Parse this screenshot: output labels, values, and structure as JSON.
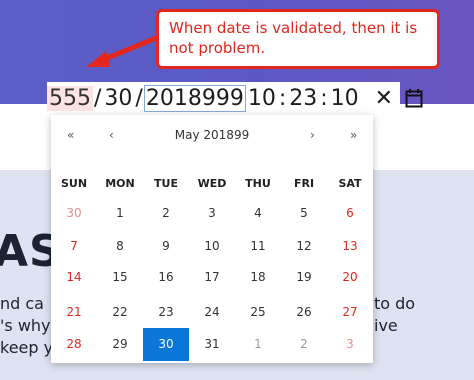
{
  "callout": {
    "text": "When date is validated, then it is not problem."
  },
  "datetime_input": {
    "month": "555",
    "sep1": "/",
    "day": "30",
    "sep2": "/",
    "year": "2018999",
    "hour": "10",
    "colon1": ":",
    "minute": "23",
    "colon2": ":",
    "second": "10",
    "clear_icon": "clear-x-icon",
    "calendar_icon": "calendar-icon"
  },
  "calendar": {
    "nav_prev_year": "«",
    "nav_prev_month": "‹",
    "title": "May 201899",
    "nav_next_month": "›",
    "nav_next_year": "»",
    "weekdays": [
      "SUN",
      "MON",
      "TUE",
      "WED",
      "THU",
      "FRI",
      "SAT"
    ],
    "weeks": [
      [
        "30",
        "1",
        "2",
        "3",
        "4",
        "5",
        "6"
      ],
      [
        "7",
        "8",
        "9",
        "10",
        "11",
        "12",
        "13"
      ],
      [
        "14",
        "15",
        "16",
        "17",
        "18",
        "19",
        "20"
      ],
      [
        "21",
        "22",
        "23",
        "24",
        "25",
        "26",
        "27"
      ],
      [
        "28",
        "29",
        "30",
        "31",
        "1",
        "2",
        "3"
      ]
    ],
    "selected_day": "30"
  },
  "background": {
    "heading_fragment": "AST",
    "left_lines": [
      "nd ca",
      "'s why",
      "keep y"
    ],
    "right_lines": [
      "to do",
      "ive"
    ]
  },
  "colors": {
    "accent": "#0b76d8",
    "weekend": "#e3261e",
    "callout": "#e3261e",
    "hero": "#5b5fc8"
  }
}
